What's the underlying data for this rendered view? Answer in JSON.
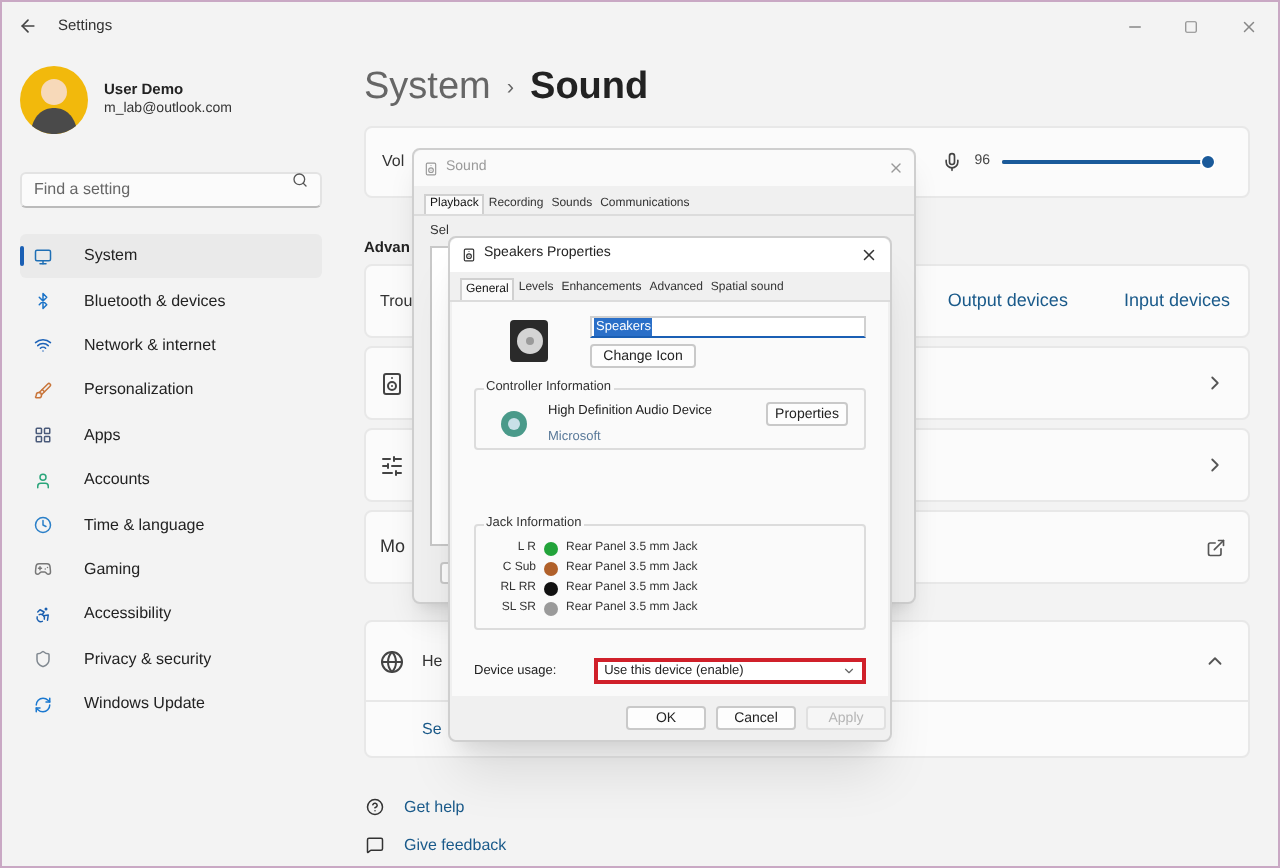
{
  "window": {
    "title": "Settings"
  },
  "user": {
    "name": "User Demo",
    "email": "m_lab@outlook.com"
  },
  "search": {
    "placeholder": "Find a setting"
  },
  "nav": [
    {
      "label": "System",
      "selected": true
    },
    {
      "label": "Bluetooth & devices",
      "selected": false
    },
    {
      "label": "Network & internet",
      "selected": false
    },
    {
      "label": "Personalization",
      "selected": false
    },
    {
      "label": "Apps",
      "selected": false
    },
    {
      "label": "Accounts",
      "selected": false
    },
    {
      "label": "Time & language",
      "selected": false
    },
    {
      "label": "Gaming",
      "selected": false
    },
    {
      "label": "Accessibility",
      "selected": false
    },
    {
      "label": "Privacy & security",
      "selected": false
    },
    {
      "label": "Windows Update",
      "selected": false
    }
  ],
  "breadcrumb": {
    "parent": "System",
    "separator": "›",
    "current": "Sound"
  },
  "volume": {
    "label": "Vol",
    "reading": "96",
    "level": 0.96
  },
  "section_heading": "Advan",
  "cards": [
    {
      "kind": "links",
      "label": "Trou",
      "links": [
        "Output devices",
        "Input devices"
      ]
    },
    {
      "kind": "speaker"
    },
    {
      "kind": "mixer"
    },
    {
      "kind": "external",
      "label": "Mo"
    },
    {
      "kind": "expand",
      "label": "He",
      "expanded": true,
      "sub": "Se"
    }
  ],
  "footer_links": [
    "Get help",
    "Give feedback"
  ],
  "sound_dialog": {
    "title": "Sound",
    "tabs": [
      {
        "label": "Playback",
        "selected": true
      },
      {
        "label": "Recording",
        "selected": false
      },
      {
        "label": "Sounds",
        "selected": false
      },
      {
        "label": "Communications",
        "selected": false
      }
    ],
    "hint": "Sel"
  },
  "properties_dialog": {
    "title": "Speakers Properties",
    "tabs": [
      {
        "label": "General",
        "selected": true
      },
      {
        "label": "Levels",
        "selected": false
      },
      {
        "label": "Enhancements",
        "selected": false
      },
      {
        "label": "Advanced",
        "selected": false
      },
      {
        "label": "Spatial sound",
        "selected": false
      }
    ],
    "name_value": "Speakers",
    "change_icon": "Change Icon",
    "controller": {
      "heading": "Controller Information",
      "name": "High Definition Audio Device",
      "vendor": "Microsoft",
      "button": "Properties"
    },
    "jacks": {
      "heading": "Jack Information",
      "items": [
        {
          "channel": "L R",
          "color": "#22a33a",
          "label": "Rear Panel 3.5 mm Jack"
        },
        {
          "channel": "C Sub",
          "color": "#b0602a",
          "label": "Rear Panel 3.5 mm Jack"
        },
        {
          "channel": "RL RR",
          "color": "#111111",
          "label": "Rear Panel 3.5 mm Jack"
        },
        {
          "channel": "SL SR",
          "color": "#9a9a9a",
          "label": "Rear Panel 3.5 mm Jack"
        }
      ]
    },
    "device_usage": {
      "label": "Device usage:",
      "value": "Use this device (enable)",
      "highlighted": true
    },
    "buttons": [
      {
        "label": "OK",
        "disabled": false
      },
      {
        "label": "Cancel",
        "disabled": false
      },
      {
        "label": "Apply",
        "disabled": true
      }
    ]
  }
}
